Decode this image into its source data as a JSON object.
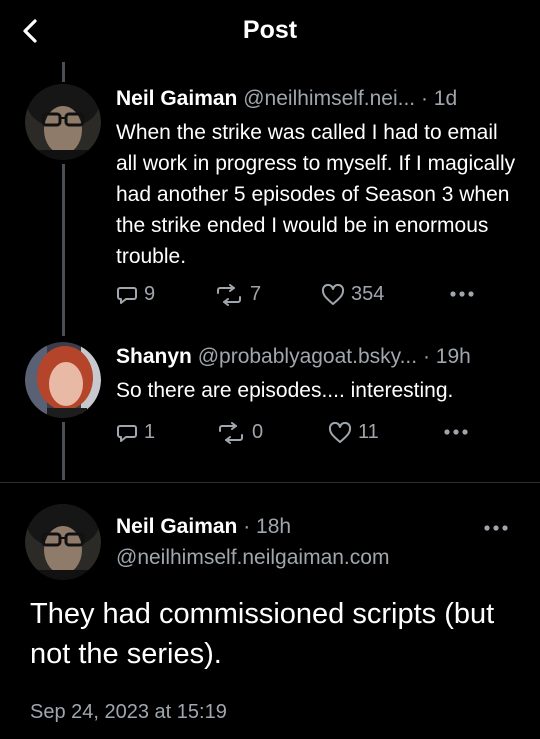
{
  "header": {
    "title": "Post"
  },
  "posts": [
    {
      "name": "Neil Gaiman",
      "handle": "@neilhimself.nei...",
      "time": "· 1d",
      "text": "When the strike was called I had to email all work in progress to myself. If I magically had another 5 episodes of Season 3 when the strike ended I would be in enormous trouble.",
      "replies": "9",
      "reposts": "7",
      "likes": "354"
    },
    {
      "name": "Shanyn",
      "handle": "@probablyagoat.bsky...",
      "time": "· 19h",
      "text": "So there are episodes.... interesting.",
      "replies": "1",
      "reposts": "0",
      "likes": "11"
    }
  ],
  "main_post": {
    "name": "Neil Gaiman",
    "time": "· 18h",
    "handle": "@neilhimself.neilgaiman.com",
    "text": "They had commissioned scripts (but not the series).",
    "timestamp": "Sep 24, 2023 at 15:19"
  },
  "icons": {
    "back": "chevron-left-icon",
    "reply": "speech-bubble-icon",
    "repost": "repost-arrows-icon",
    "like": "heart-icon",
    "more": "ellipsis-icon"
  }
}
